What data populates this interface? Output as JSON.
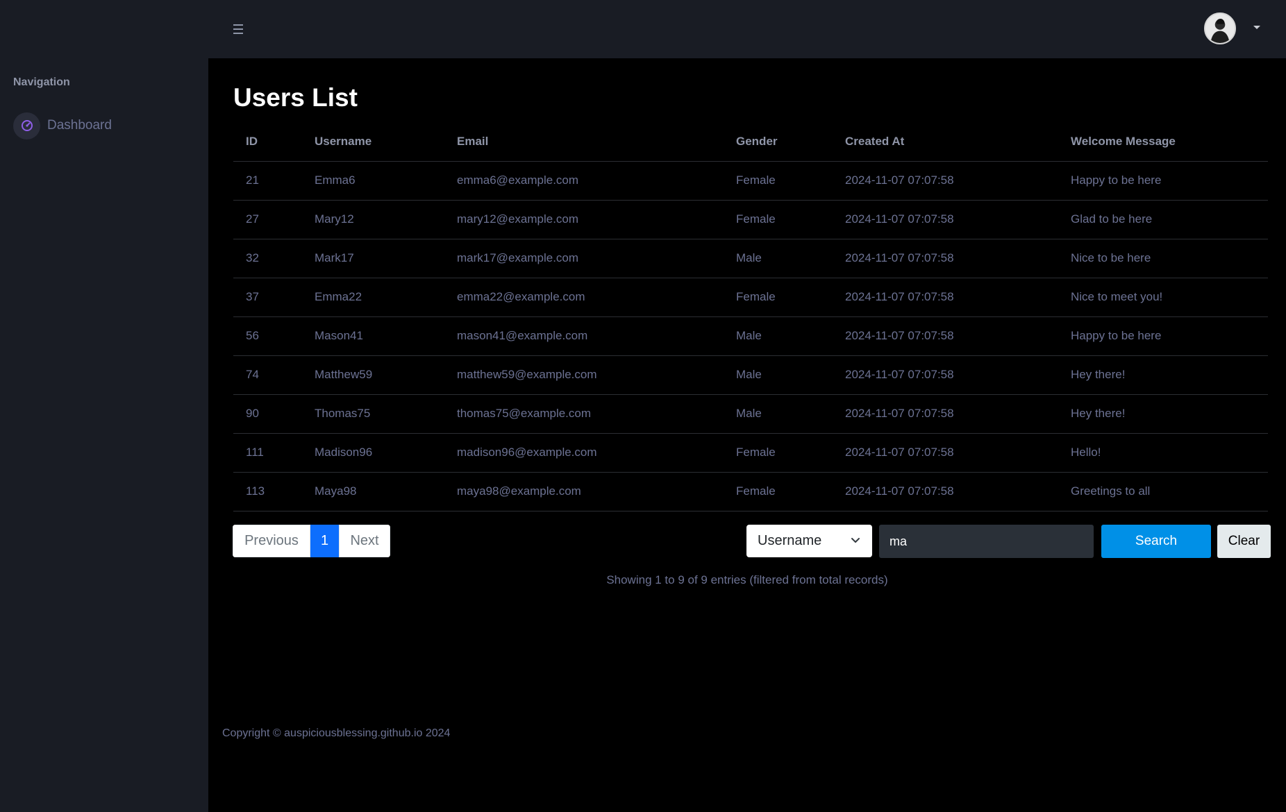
{
  "navbar": {
    "menu_icon": "hamburger-menu-icon",
    "avatar_icon": "user-avatar",
    "dropdown_icon": "caret-down-icon"
  },
  "sidebar": {
    "heading": "Navigation",
    "items": [
      {
        "label": "Dashboard",
        "icon": "speedometer-icon",
        "icon_color": "#8f5fe8"
      }
    ]
  },
  "main": {
    "title": "Users List",
    "table": {
      "columns": [
        "ID",
        "Username",
        "Email",
        "Gender",
        "Created At",
        "Welcome Message"
      ],
      "rows": [
        [
          "21",
          "Emma6",
          "emma6@example.com",
          "Female",
          "2024-11-07 07:07:58",
          "Happy to be here"
        ],
        [
          "27",
          "Mary12",
          "mary12@example.com",
          "Female",
          "2024-11-07 07:07:58",
          "Glad to be here"
        ],
        [
          "32",
          "Mark17",
          "mark17@example.com",
          "Male",
          "2024-11-07 07:07:58",
          "Nice to be here"
        ],
        [
          "37",
          "Emma22",
          "emma22@example.com",
          "Female",
          "2024-11-07 07:07:58",
          "Nice to meet you!"
        ],
        [
          "56",
          "Mason41",
          "mason41@example.com",
          "Male",
          "2024-11-07 07:07:58",
          "Happy to be here"
        ],
        [
          "74",
          "Matthew59",
          "matthew59@example.com",
          "Male",
          "2024-11-07 07:07:58",
          "Hey there!"
        ],
        [
          "90",
          "Thomas75",
          "thomas75@example.com",
          "Male",
          "2024-11-07 07:07:58",
          "Hey there!"
        ],
        [
          "111",
          "Madison96",
          "madison96@example.com",
          "Female",
          "2024-11-07 07:07:58",
          "Hello!"
        ],
        [
          "113",
          "Maya98",
          "maya98@example.com",
          "Female",
          "2024-11-07 07:07:58",
          "Greetings to all"
        ]
      ]
    },
    "pagination": {
      "previous_label": "Previous",
      "current_page": "1",
      "next_label": "Next"
    },
    "search": {
      "field_selected": "Username",
      "query_value": "ma",
      "search_label": "Search",
      "clear_label": "Clear"
    },
    "info_text": "Showing 1 to 9 of 9 entries (filtered from total records)"
  },
  "footer": {
    "text": "Copyright © auspiciousblessing.github.io 2024"
  },
  "colors": {
    "sidebar_bg": "#191c24",
    "main_bg": "#000000",
    "accent_blue": "#0090e7",
    "page_active": "#0d6efd",
    "text_muted": "#6c7293"
  }
}
